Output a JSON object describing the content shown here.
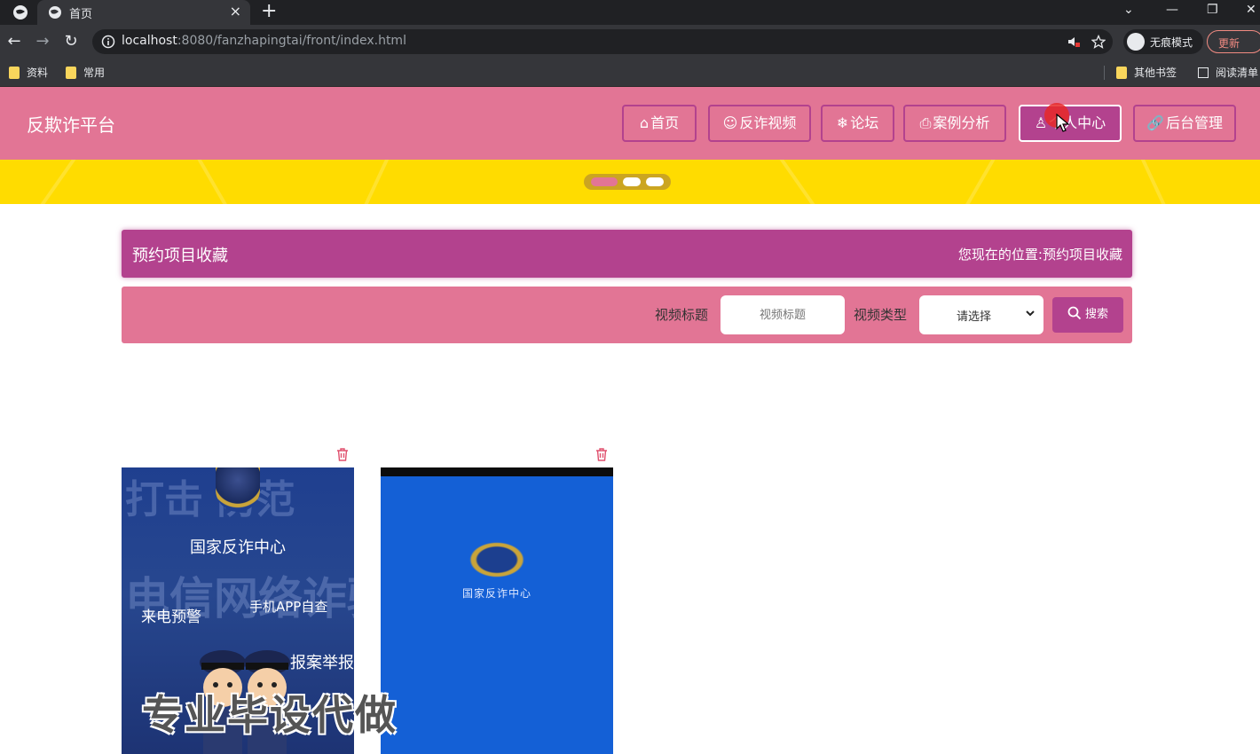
{
  "browser": {
    "tab_title": "首页",
    "new_tab": "+",
    "tab_close": "×",
    "url_host": "localhost",
    "url_rest": ":8080/fanzhapingtai/front/index.html",
    "incognito_label": "无痕模式",
    "update_label": "更新",
    "bookmarks": [
      "资料",
      "常用"
    ],
    "other_bookmarks": "其他书签",
    "reading_list": "阅读清单"
  },
  "site": {
    "title": "反欺诈平台",
    "nav": [
      {
        "label": "首页",
        "icon": "home-icon"
      },
      {
        "label": "反诈视频",
        "icon": "smile-icon"
      },
      {
        "label": "论坛",
        "icon": "snowflake-icon"
      },
      {
        "label": "案例分析",
        "icon": "printer-icon"
      },
      {
        "label": "个人中心",
        "icon": "user-icon"
      },
      {
        "label": "后台管理",
        "icon": "link-icon"
      }
    ],
    "active_nav": "个人中心"
  },
  "banner": {
    "slides": 3,
    "active_slide": 1
  },
  "breadcrumb": {
    "title": "预约项目收藏",
    "location_prefix": "您现在的位置:",
    "location": "预约项目收藏"
  },
  "search": {
    "title_label": "视频标题",
    "title_placeholder": "视频标题",
    "type_label": "视频类型",
    "type_value": "请选择",
    "button_label": "搜索"
  },
  "favorites": [
    {
      "center_text": "国家反诈中心",
      "bg_text_1": "打击 防范",
      "bg_text_2": "电信网络诈骗",
      "tag_1": "来电预警",
      "tag_2": "手机APP自查",
      "tag_3": "报案举报"
    },
    {
      "center_text": "国家反诈中心"
    }
  ],
  "watermark": "专业毕设代做",
  "colors": {
    "primary": "#e27595",
    "accent": "#b3428e",
    "banner": "#ffdc00"
  }
}
